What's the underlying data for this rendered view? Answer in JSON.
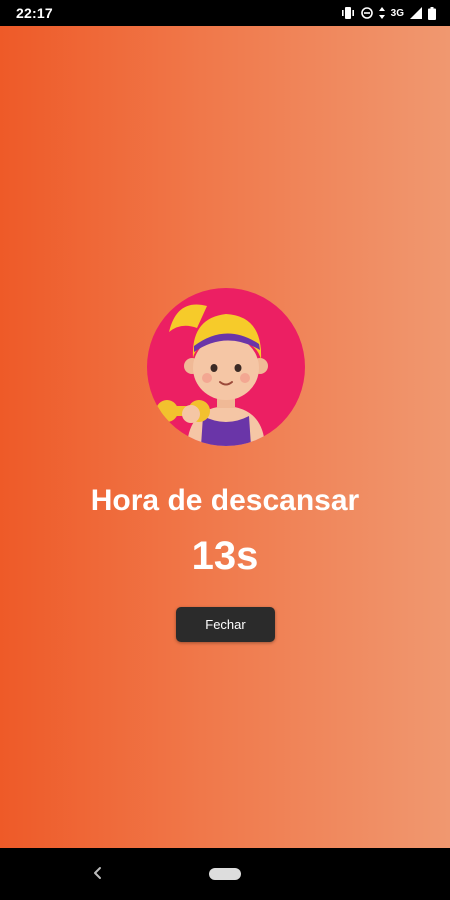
{
  "status_bar": {
    "time": "22:17",
    "network_label": "3G",
    "icons": [
      "vibrate-icon",
      "do-not-disturb-icon",
      "data-arrows-icon",
      "signal-icon",
      "battery-icon"
    ]
  },
  "screen": {
    "title": "Hora de descansar",
    "timer": "13s",
    "close_label": "Fechar",
    "avatar_icon": "fitness-girl-avatar",
    "colors": {
      "gradient_start": "#ee5a28",
      "gradient_end": "#f09870",
      "avatar_circle": "#ec1f63",
      "button": "#2b2b2b"
    }
  },
  "nav_bar": {
    "back_icon": "back-chevron-icon",
    "home_icon": "home-pill-icon"
  }
}
